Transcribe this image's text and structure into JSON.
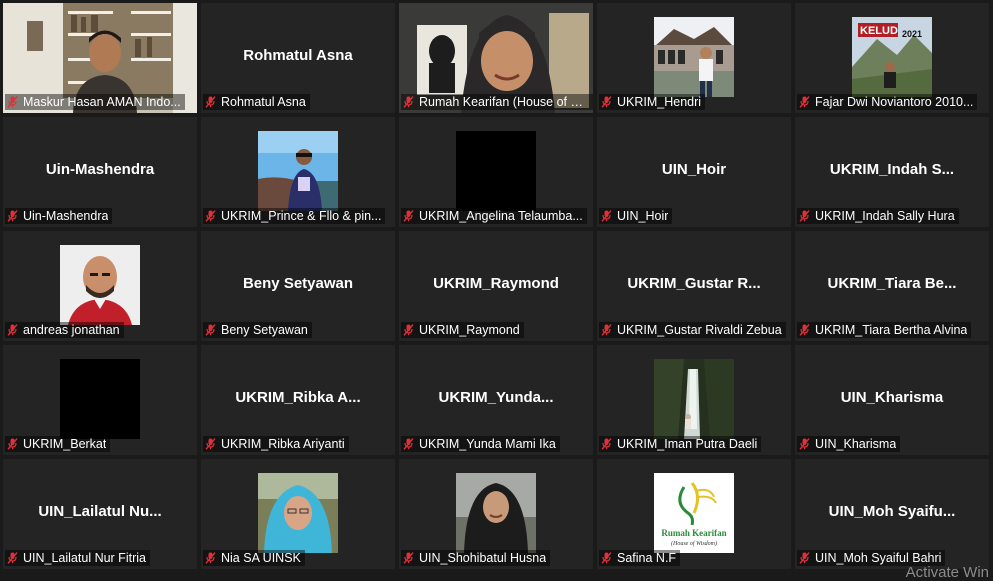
{
  "participants": [
    {
      "label": "Maskur Hasan AMAN Indo...",
      "type": "video",
      "art": "bookshelf-man"
    },
    {
      "label": "Rohmatul Asna",
      "type": "name",
      "display": "Rohmatul Asna"
    },
    {
      "label": "Rumah Kearifan (House of Wi...",
      "type": "video",
      "art": "woman-hijab",
      "active": true
    },
    {
      "label": "UKRIM_Hendri",
      "type": "photo",
      "art": "man-sign"
    },
    {
      "label": "Fajar Dwi Noviantoro 2010...",
      "type": "photo",
      "art": "mountain-sign"
    },
    {
      "label": "Uin-Mashendra",
      "type": "name",
      "display": "Uin-Mashendra"
    },
    {
      "label": "UKRIM_Prince & Fllo & pin...",
      "type": "photo",
      "art": "beach-woman"
    },
    {
      "label": "UKRIM_Angelina Telaumba...",
      "type": "black"
    },
    {
      "label": "UIN_Hoir",
      "type": "name",
      "display": "UIN_Hoir"
    },
    {
      "label": "UKRIM_Indah Sally Hura",
      "type": "name",
      "display": "UKRIM_Indah  S..."
    },
    {
      "label": "andreas jonathan",
      "type": "photo",
      "art": "bald-man"
    },
    {
      "label": "Beny Setyawan",
      "type": "name",
      "display": "Beny Setyawan"
    },
    {
      "label": "UKRIM_Raymond",
      "type": "name",
      "display": "UKRIM_Raymond"
    },
    {
      "label": "UKRIM_Gustar Rivaldi Zebua",
      "type": "name",
      "display": "UKRIM_Gustar  R..."
    },
    {
      "label": "UKRIM_Tiara Bertha Alvina",
      "type": "name",
      "display": "UKRIM_Tiara  Be..."
    },
    {
      "label": "UKRIM_Berkat",
      "type": "black"
    },
    {
      "label": "UKRIM_Ribka Ariyanti",
      "type": "name",
      "display": "UKRIM_Ribka  A..."
    },
    {
      "label": "UKRIM_Yunda Mami Ika",
      "type": "name",
      "display": "UKRIM_Yunda..."
    },
    {
      "label": "UKRIM_Iman Putra Daeli",
      "type": "photo",
      "art": "waterfall"
    },
    {
      "label": "UIN_Kharisma",
      "type": "name",
      "display": "UIN_Kharisma"
    },
    {
      "label": "UIN_Lailatul Nur Fitria",
      "type": "name",
      "display": "UIN_Lailatul  Nu..."
    },
    {
      "label": "Nia SA UINSK",
      "type": "photo",
      "art": "blue-hijab"
    },
    {
      "label": "UIN_Shohibatul Husna",
      "type": "photo",
      "art": "dark-hijab"
    },
    {
      "label": "Safina N.F",
      "type": "photo",
      "art": "logo"
    },
    {
      "label": "UIN_Moh Syaiful Bahri",
      "type": "name",
      "display": "UIN_Moh  Syaifu..."
    }
  ],
  "logo_text": {
    "line1": "Rumah Kearifan",
    "line2": "(House of Wisdom)"
  },
  "sign_text": {
    "kelud": "KELUD",
    "year": "2021"
  },
  "watermark": "Activate Win",
  "colors": {
    "active_border": "#d9d760",
    "muted_mic": "#e0303a",
    "tile_bg": "#242424"
  },
  "icons": {
    "mic": "muted-microphone-icon"
  }
}
